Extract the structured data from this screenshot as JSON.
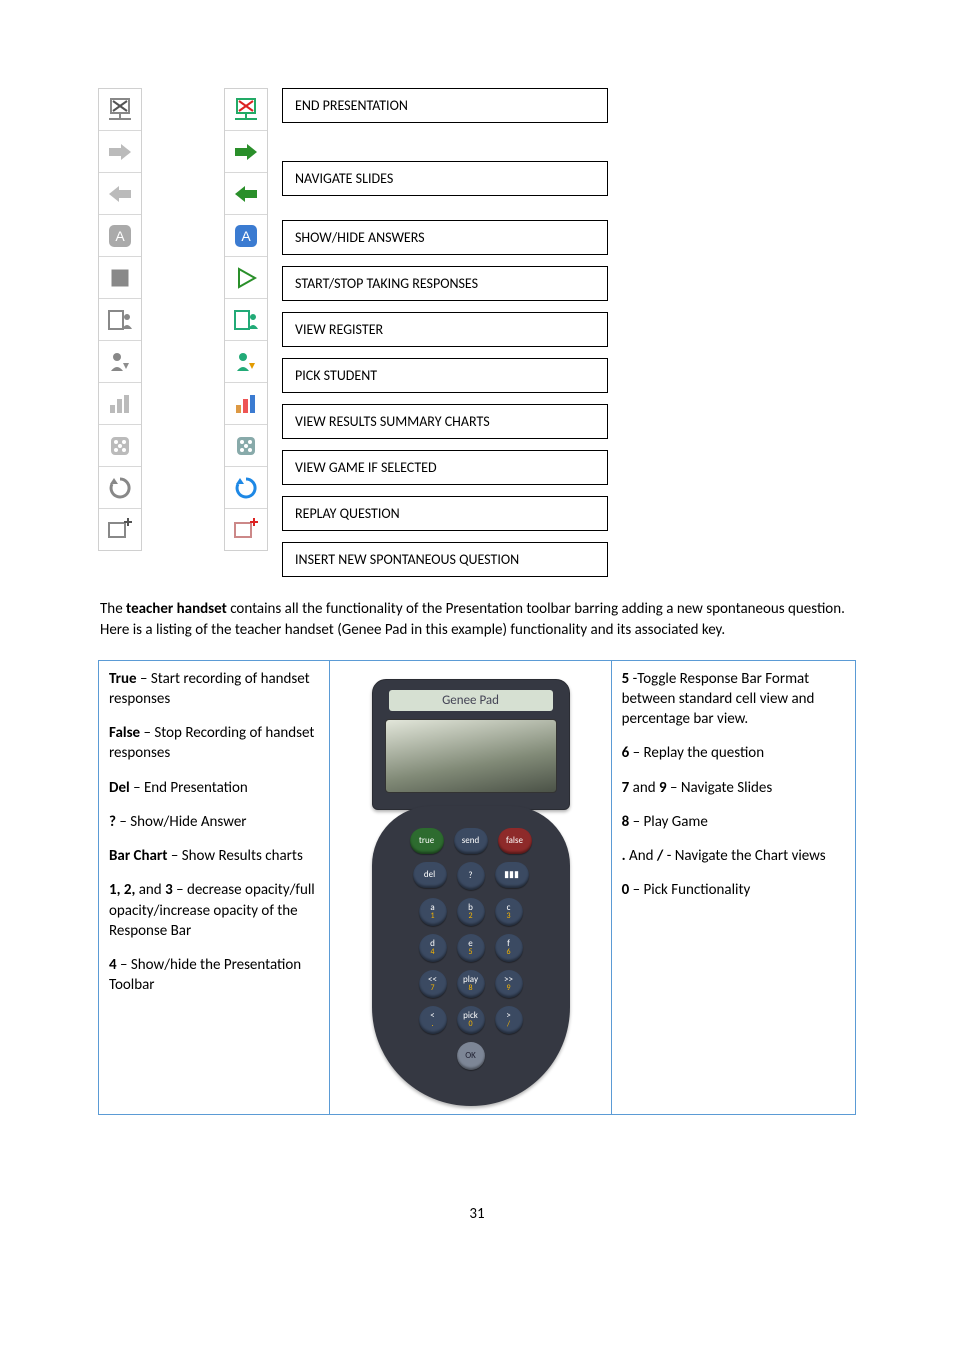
{
  "toolbar_labels": {
    "end_presentation": "END PRESENTATION",
    "navigate_slides": "NAVIGATE SLIDES",
    "show_hide_answers": "SHOW/HIDE ANSWERS",
    "start_stop_responses": "START/STOP TAKING RESPONSES",
    "view_register": "VIEW REGISTER",
    "pick_student": "PICK STUDENT",
    "view_results": "VIEW RESULTS SUMMARY CHARTS",
    "view_game": "VIEW GAME IF SELECTED",
    "replay_question": "REPLAY QUESTION",
    "insert_spontaneous": "INSERT NEW SPONTANEOUS QUESTION"
  },
  "body_text": {
    "p1a": "The ",
    "p1b": "teacher handset",
    "p1c": " contains all the functionality of the Presentation toolbar barring adding a new spontaneous question.  Here is a listing of the teacher handset (Genee Pad in this example) functionality and its associated key."
  },
  "handset": {
    "left": {
      "true_label": "True",
      "true_text": " – Start recording of handset responses",
      "false_label": "False",
      "false_text": " – Stop Recording of handset responses",
      "del_label": "Del",
      "del_text": " – End Presentation",
      "q_label": "?",
      "q_text": " – Show/Hide Answer",
      "bar_label": "Bar Chart",
      "bar_text": " – Show Results charts",
      "n123_label": "1, 2,",
      "n123_and": " and ",
      "n3_label": "3",
      "n123_text": " – decrease opacity/full opacity/increase opacity of the Response Bar",
      "n4_label": "4",
      "n4_text": " – Show/hide the Presentation Toolbar"
    },
    "right": {
      "n5_label": "5",
      "n5_text": " -Toggle Response Bar Format between standard cell view and percentage bar view.",
      "n6_label": "6",
      "n6_text": " – Replay the question",
      "n7_label": "7",
      "n7_and": " and ",
      "n9_label": "9",
      "n79_text": " – Navigate Slides",
      "n8_label": "8",
      "n8_text": " – Play Game",
      "dot_label": ".",
      "dot_and": " And ",
      "slash_label": "/",
      "dot_text": " - Navigate the Chart views",
      "n0_label": "0",
      "n0_text": " – Pick Functionality"
    },
    "device_label": "Genee Pad",
    "keys": {
      "true": "true",
      "send": "send",
      "false": "false",
      "del": "del",
      "q": "?",
      "chart": "▮▮▮",
      "a1": "a",
      "a1n": "1",
      "b2": "b",
      "b2n": "2",
      "c3": "c",
      "c3n": "3",
      "d4": "d",
      "d4n": "4",
      "e5": "e",
      "e5n": "5",
      "f6": "f",
      "f6n": "6",
      "ll": "<<",
      "lln": "7",
      "play": "play",
      "playn": "8",
      "rr": ">>",
      "rrn": "9",
      "lt": "<",
      "ltn": ".",
      "pick": "pick",
      "pickn": "0",
      "gt": ">",
      "gtn": "/",
      "ok": "OK"
    }
  },
  "page_number": "31"
}
